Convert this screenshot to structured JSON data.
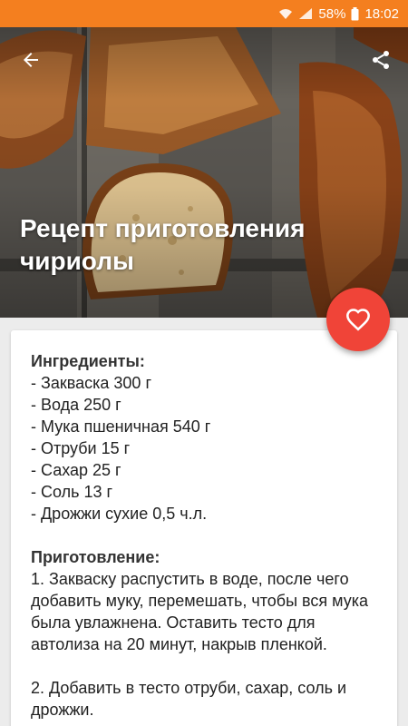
{
  "status_bar": {
    "battery_percent": "58%",
    "time": "18:02",
    "icons": [
      "wifi-icon",
      "signal-icon",
      "battery-icon"
    ]
  },
  "header": {
    "title": "Рецепт приготовления чириолы",
    "back_icon": "arrow-back-icon",
    "share_icon": "share-icon"
  },
  "fab": {
    "icon": "heart-outline-icon",
    "color": "#f04438"
  },
  "recipe": {
    "ingredients_title": "Ингредиенты:",
    "ingredients": [
      "- Закваска 300 г",
      "- Вода 250 г",
      "- Мука пшеничная 540 г",
      "- Отруби 15 г",
      "- Сахар 25 г",
      "- Соль 13 г",
      "- Дрожжи сухие 0,5 ч.л."
    ],
    "preparation_title": "Приготовление:",
    "steps": [
      "1. Закваску распустить в воде, после чего добавить муку, перемешать, чтобы вся мука была увлажнена. Оставить тесто для автолиза на 20 минут, накрыв пленкой.",
      "2. Добавить в тесто отруби, сахар, соль и дрожжи."
    ]
  },
  "colors": {
    "status_bar": "#f47f1f",
    "accent": "#f04438",
    "card_bg": "#ffffff"
  }
}
